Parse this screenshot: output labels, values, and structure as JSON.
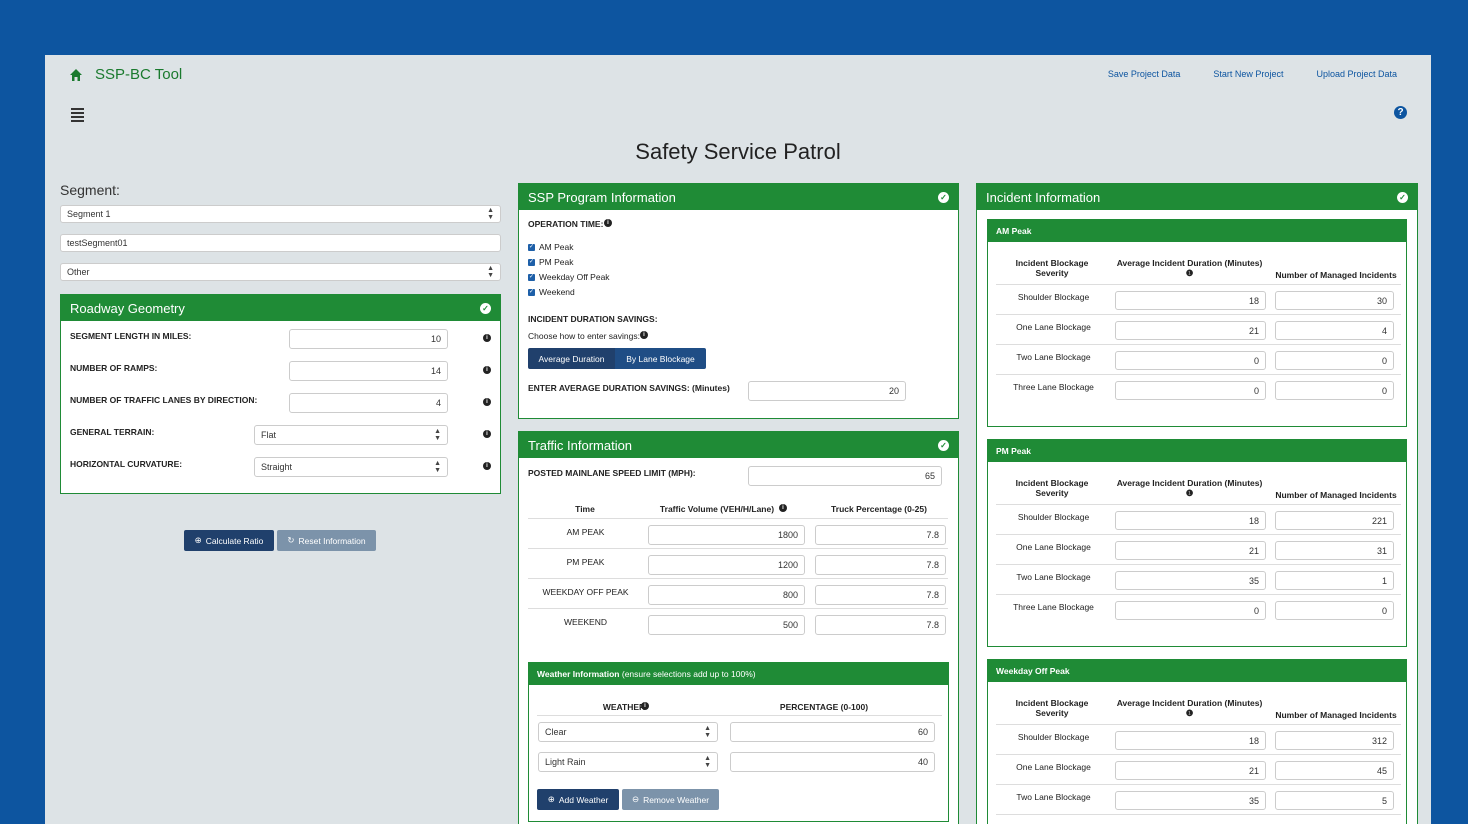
{
  "header": {
    "brand": "SSP-BC Tool",
    "links": [
      "Save Project Data",
      "Start New Project",
      "Upload Project Data"
    ],
    "page_title": "Safety Service Patrol"
  },
  "segment": {
    "label": "Segment:",
    "selected": "Segment 1",
    "name": "testSegment01",
    "type": "Other"
  },
  "roadway": {
    "title": "Roadway Geometry",
    "length_label": "SEGMENT LENGTH IN MILES:",
    "length": "10",
    "ramps_label": "NUMBER OF RAMPS:",
    "ramps": "14",
    "lanes_label": "NUMBER OF TRAFFIC LANES BY DIRECTION:",
    "lanes": "4",
    "terrain_label": "GENERAL TERRAIN:",
    "terrain": "Flat",
    "curvature_label": "HORIZONTAL CURVATURE:",
    "curvature": "Straight"
  },
  "actions": {
    "calculate": "Calculate Ratio",
    "reset": "Reset Information"
  },
  "ssp": {
    "title": "SSP Program Information",
    "operation_label": "OPERATION TIME:",
    "options": [
      "AM Peak",
      "PM Peak",
      "Weekday Off Peak",
      "Weekend"
    ],
    "savings_label": "INCIDENT DURATION SAVINGS:",
    "choose_label": "Choose how to enter savings:",
    "btn_avg": "Average Duration",
    "btn_lane": "By Lane Blockage",
    "avg_label": "ENTER AVERAGE DURATION SAVINGS: (Minutes)",
    "avg_value": "20"
  },
  "traffic": {
    "title": "Traffic Information",
    "speed_label": "POSTED MAINLANE SPEED LIMIT (MPH):",
    "speed": "65",
    "col_time": "Time",
    "col_volume": "Traffic Volume (VEH/H/Lane)",
    "col_truck": "Truck Percentage (0-25)",
    "rows": [
      {
        "time": "AM PEAK",
        "volume": "1800",
        "truck": "7.8"
      },
      {
        "time": "PM PEAK",
        "volume": "1200",
        "truck": "7.8"
      },
      {
        "time": "WEEKDAY OFF PEAK",
        "volume": "800",
        "truck": "7.8"
      },
      {
        "time": "WEEKEND",
        "volume": "500",
        "truck": "7.8"
      }
    ]
  },
  "weather": {
    "title_bold": "Weather Information",
    "title_note": "(ensure selections add up to 100%)",
    "col_weather": "WEATHER",
    "col_pct": "PERCENTAGE (0-100)",
    "rows": [
      {
        "weather": "Clear",
        "pct": "60"
      },
      {
        "weather": "Light Rain",
        "pct": "40"
      }
    ],
    "add": "Add Weather",
    "remove": "Remove Weather"
  },
  "incident": {
    "title": "Incident Information",
    "col_sev_1": "Incident Blockage",
    "col_sev_2": "Severity",
    "col_dur": "Average Incident Duration (Minutes)",
    "col_num": "Number of Managed Incidents",
    "am": {
      "title": "AM Peak",
      "rows": [
        {
          "label": "Shoulder Blockage",
          "dur": "18",
          "num": "30"
        },
        {
          "label": "One Lane Blockage",
          "dur": "21",
          "num": "4"
        },
        {
          "label": "Two Lane Blockage",
          "dur": "0",
          "num": "0"
        },
        {
          "label": "Three Lane Blockage",
          "dur": "0",
          "num": "0"
        }
      ]
    },
    "pm": {
      "title": "PM Peak",
      "rows": [
        {
          "label": "Shoulder Blockage",
          "dur": "18",
          "num": "221"
        },
        {
          "label": "One Lane Blockage",
          "dur": "21",
          "num": "31"
        },
        {
          "label": "Two Lane Blockage",
          "dur": "35",
          "num": "1"
        },
        {
          "label": "Three Lane Blockage",
          "dur": "0",
          "num": "0"
        }
      ]
    },
    "off": {
      "title": "Weekday Off Peak",
      "rows": [
        {
          "label": "Shoulder Blockage",
          "dur": "18",
          "num": "312"
        },
        {
          "label": "One Lane Blockage",
          "dur": "21",
          "num": "45"
        },
        {
          "label": "Two Lane Blockage",
          "dur": "35",
          "num": "5"
        }
      ]
    }
  }
}
